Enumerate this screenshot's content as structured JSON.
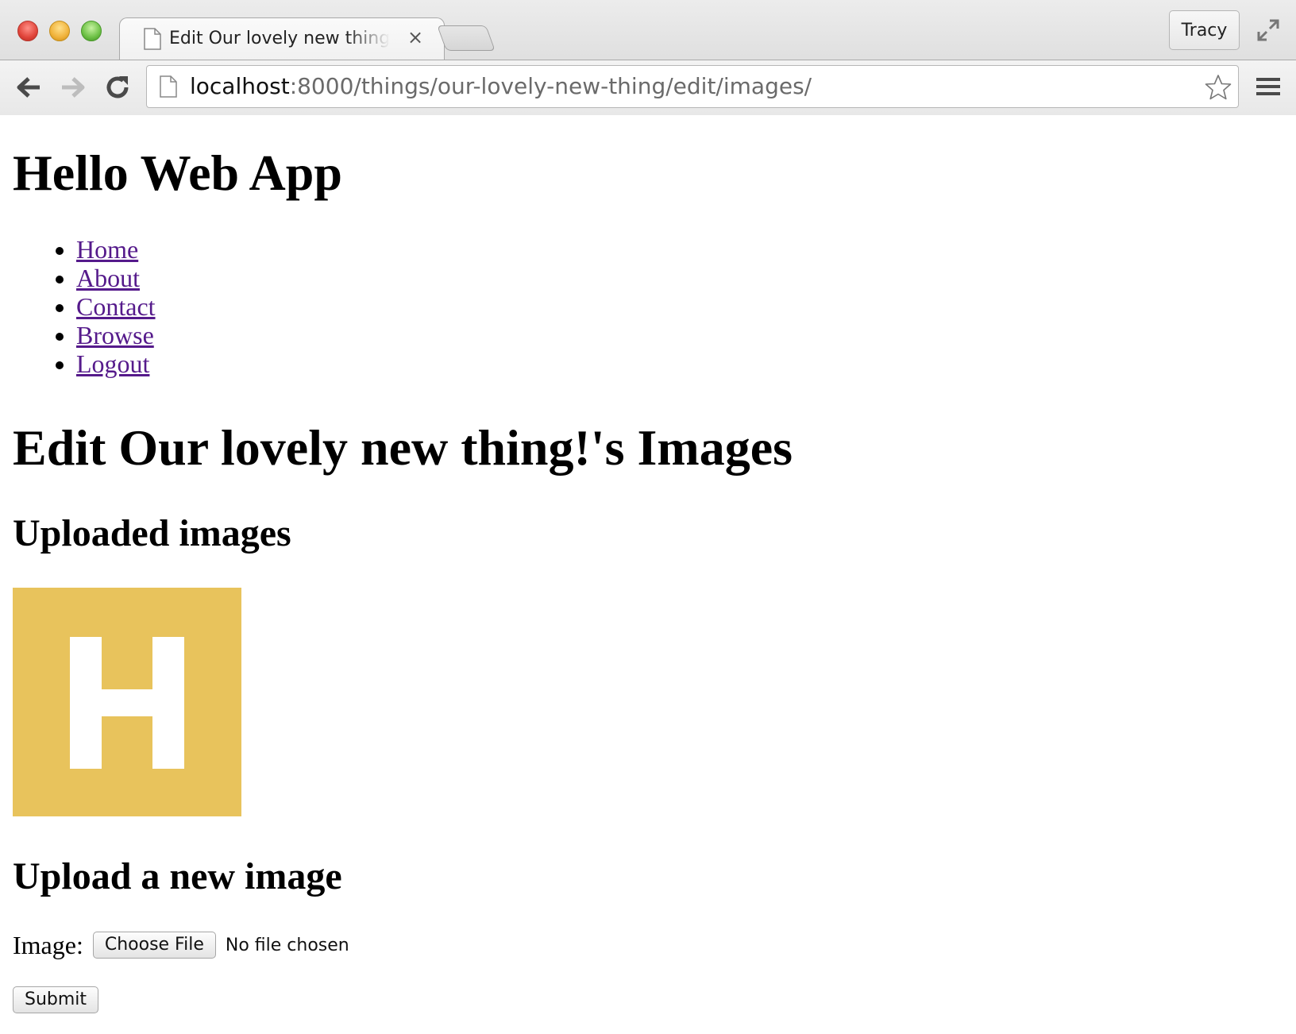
{
  "window": {
    "tab_title": "Edit Our lovely new thing!'s Images",
    "tab_close": "×",
    "profile_name": "Tracy"
  },
  "address_bar": {
    "host": "localhost",
    "path": ":8000/things/our-lovely-new-thing/edit/images/"
  },
  "page": {
    "site_title": "Hello Web App",
    "nav": [
      {
        "label": "Home"
      },
      {
        "label": "About"
      },
      {
        "label": "Contact"
      },
      {
        "label": "Browse"
      },
      {
        "label": "Logout"
      }
    ],
    "heading": "Edit Our lovely new thing!'s Images",
    "uploaded_heading": "Uploaded images",
    "uploaded_image": {
      "letter": "H",
      "background": "#e8c35c",
      "letter_color": "#ffffff"
    },
    "upload_heading": "Upload a new image",
    "form": {
      "image_label": "Image:",
      "choose_file_label": "Choose File",
      "file_status": "No file chosen",
      "submit_label": "Submit"
    }
  },
  "colors": {
    "link_visited": "#551a8b",
    "chrome_bg": "#e4e4e4"
  }
}
